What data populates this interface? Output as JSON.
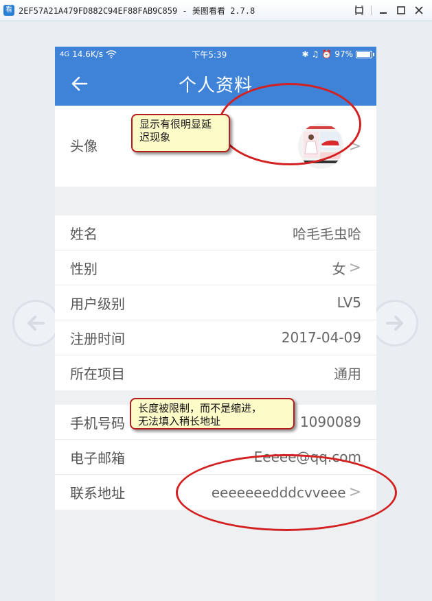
{
  "window": {
    "title": "2EF57A21A479FD882C94EF88FAB9C859 - 美图看看 2.7.8",
    "app_icon_glyph": "看",
    "controls": [
      "restore-icon",
      "minimize-icon",
      "maximize-icon",
      "close-icon"
    ]
  },
  "statusbar": {
    "signal": "4G",
    "speed": "14.6K/s",
    "time": "下午5:39",
    "battery": "97%",
    "battery_level": 0.97
  },
  "appbar": {
    "title": "个人资料"
  },
  "profile": {
    "avatar_label": "头像",
    "basic_rows": [
      {
        "label": "姓名",
        "value": "哈毛毛虫哈",
        "chevron": false
      },
      {
        "label": "性别",
        "value": "女",
        "chevron": true
      },
      {
        "label": "用户级别",
        "value": "LV5",
        "chevron": false
      },
      {
        "label": "注册时间",
        "value": "2017-04-09",
        "chevron": false
      },
      {
        "label": "所在项目",
        "value": "通用",
        "chevron": false
      }
    ],
    "contact_rows": [
      {
        "label": "手机号码",
        "value": "0089",
        "partial_value": "1090089",
        "chevron": false
      },
      {
        "label": "电子邮箱",
        "value": "Eeeee@qq.com",
        "chevron": false
      },
      {
        "label": "联系地址",
        "value": "eeeeeeedddcvveee",
        "chevron": true
      }
    ]
  },
  "annotations": {
    "callout_1": "显示有很明显延\n迟现象",
    "callout_2": "长度被限制，而不是缩进，\n无法填入稍长地址"
  },
  "colors": {
    "accent": "#3e83d8",
    "annotation_border": "#d32020",
    "callout_bg": "#fdfbc8"
  }
}
